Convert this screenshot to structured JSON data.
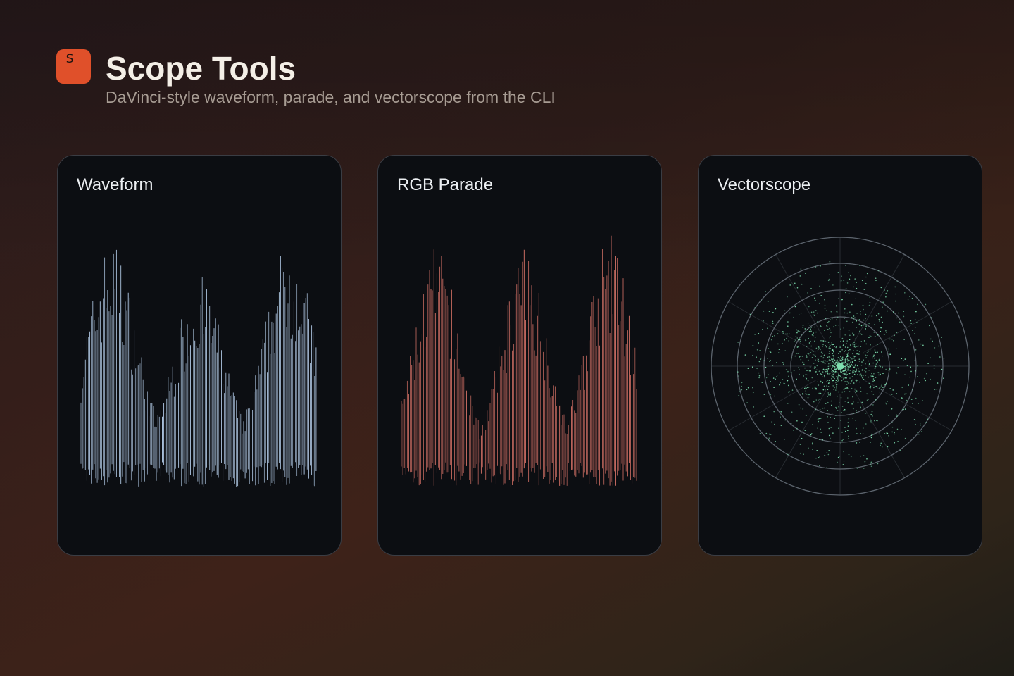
{
  "app": {
    "logo_letter": "S",
    "title": "Scope Tools",
    "subtitle": "DaVinci-style waveform, parade, and vectorscope from the CLI"
  },
  "colors": {
    "accent": "#e0502a",
    "waveform_trace": "#b9d2ef",
    "parade_trace": "#e2786c",
    "vectorscope_dots": "#7fe0b0",
    "graticule": "#5c646d"
  },
  "panels": {
    "waveform": {
      "title": "Waveform"
    },
    "parade": {
      "title": "RGB Parade"
    },
    "vectorscope": {
      "title": "Vectorscope"
    }
  }
}
